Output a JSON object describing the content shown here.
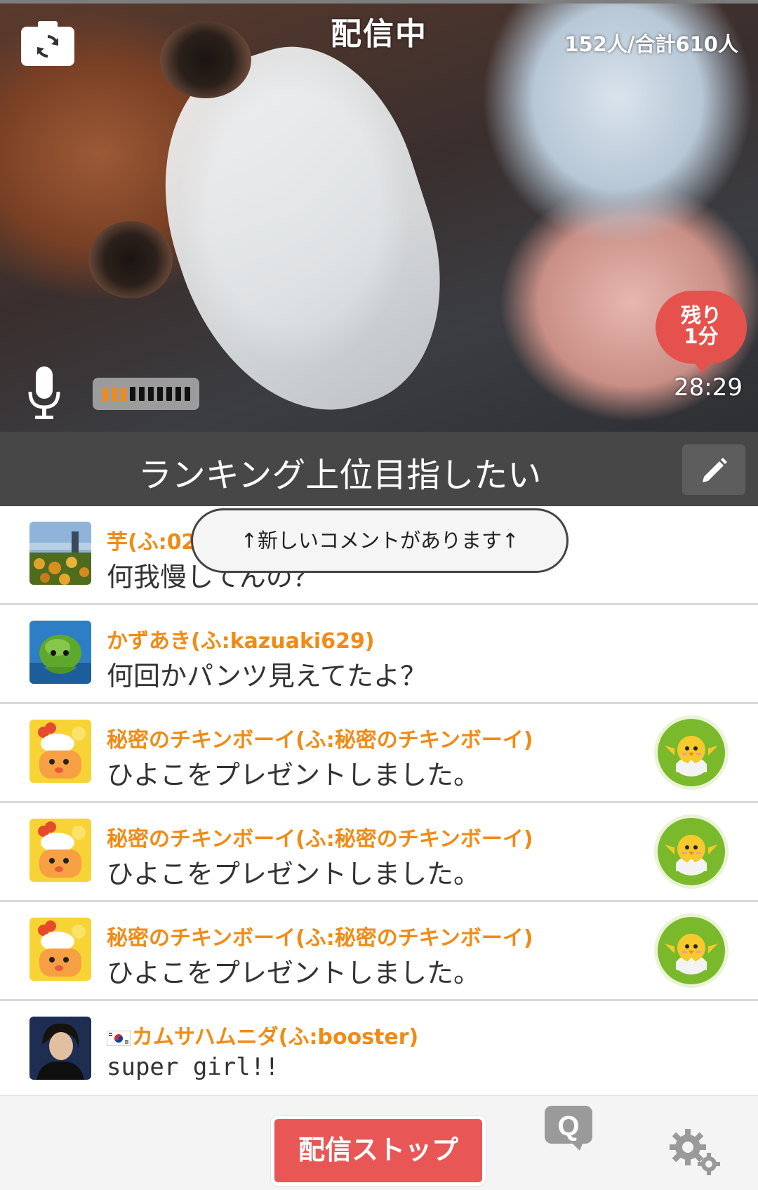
{
  "stream": {
    "status": "配信中",
    "viewers": "152人/合計610人",
    "remaining_badge_line1": "残り",
    "remaining_badge_line2": "1分",
    "elapsed_time": "28:29",
    "mic_level_segments": 10,
    "mic_level_active": 3
  },
  "title_bar": {
    "title": "ランキング上位目指したい"
  },
  "notice": {
    "new_comments": "↑新しいコメントがあります↑"
  },
  "comments": [
    {
      "name": "芋(ふ:02",
      "text": "何我慢してんの？",
      "avatar": "landscape-avatar",
      "gift": false
    },
    {
      "name": "かずあき(ふ:kazuaki629)",
      "text": "何回かパンツ見えてたよ？",
      "avatar": "green-character-avatar",
      "gift": false
    },
    {
      "name": "秘密のチキンボーイ(ふ:秘密のチキンボーイ)",
      "text": "ひよこをプレゼントしました。",
      "avatar": "chicken-avatar",
      "gift": true
    },
    {
      "name": "秘密のチキンボーイ(ふ:秘密のチキンボーイ)",
      "text": "ひよこをプレゼントしました。",
      "avatar": "chicken-avatar",
      "gift": true
    },
    {
      "name": "秘密のチキンボーイ(ふ:秘密のチキンボーイ)",
      "text": "ひよこをプレゼントしました。",
      "avatar": "chicken-avatar",
      "gift": true
    },
    {
      "name": "カムサハムニダ(ふ:booster)",
      "text": "super girl!!",
      "avatar": "person-avatar",
      "gift": false,
      "flag": "korea-flag-icon"
    }
  ],
  "bottom_bar": {
    "stop_label": "配信ストップ",
    "q_label": "Q"
  },
  "colors": {
    "accent_orange": "#f08b16",
    "stop_red": "#e85756",
    "gift_green": "#7ab92c",
    "title_bar_gray": "#474747"
  }
}
